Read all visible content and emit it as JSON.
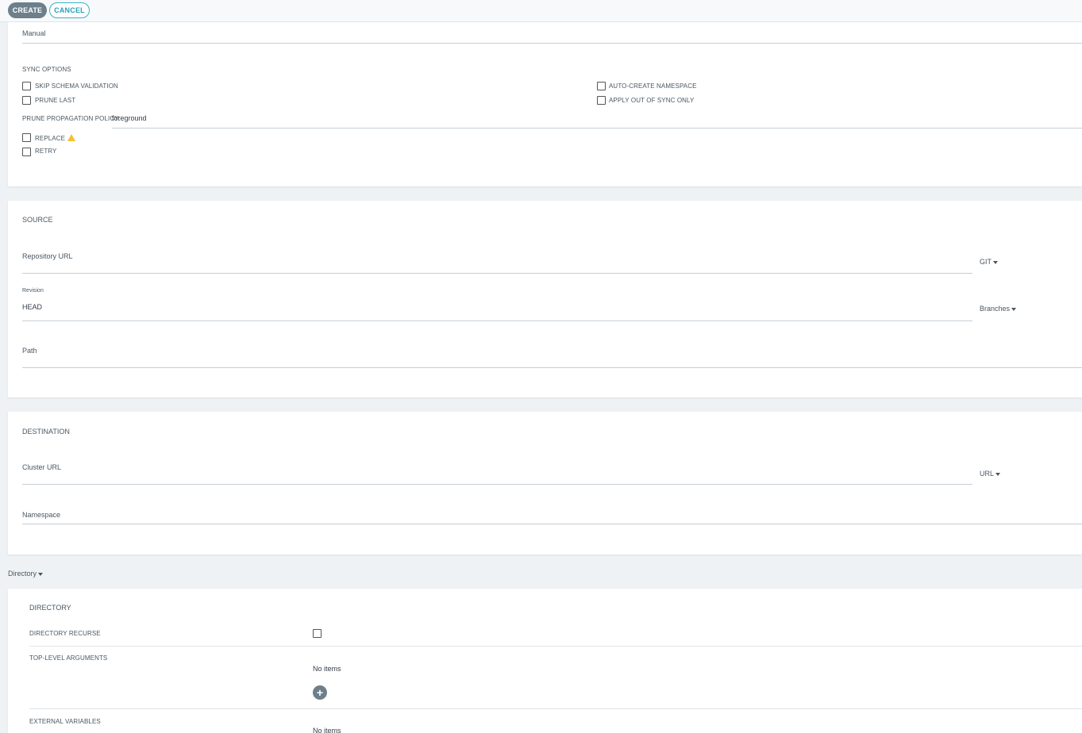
{
  "toolbar": {
    "create_label": "CREATE",
    "cancel_label": "CANCEL"
  },
  "sync_policy": {
    "mode_value": "Manual",
    "sync_options_title": "SYNC OPTIONS",
    "skip_schema_validation": "SKIP SCHEMA VALIDATION",
    "prune_last": "PRUNE LAST",
    "auto_create_namespace": "AUTO-CREATE NAMESPACE",
    "apply_out_of_sync_only": "APPLY OUT OF SYNC ONLY",
    "prune_propagation_label": "PRUNE PROPAGATION POLICY:",
    "prune_propagation_value": "foreground",
    "replace": "REPLACE",
    "retry": "RETRY"
  },
  "source": {
    "title": "SOURCE",
    "repo_url_placeholder": "Repository URL",
    "repo_type": "GIT",
    "revision_label": "Revision",
    "revision_value": "HEAD",
    "revision_type": "Branches",
    "path_placeholder": "Path"
  },
  "destination": {
    "title": "DESTINATION",
    "cluster_url_placeholder": "Cluster URL",
    "cluster_type": "URL",
    "namespace_placeholder": "Namespace"
  },
  "source_type": {
    "selected": "Directory"
  },
  "directory": {
    "title": "DIRECTORY",
    "recurse_label": "DIRECTORY RECURSE",
    "top_level_args_label": "TOP-LEVEL ARGUMENTS",
    "top_level_args_empty": "No items",
    "external_vars_label": "EXTERNAL VARIABLES",
    "external_vars_empty": "No items"
  },
  "colors": {
    "accent": "#3bb1c8",
    "primary_button": "#6d7f8b",
    "warning": "#f4c030",
    "background": "#eef2f4"
  }
}
